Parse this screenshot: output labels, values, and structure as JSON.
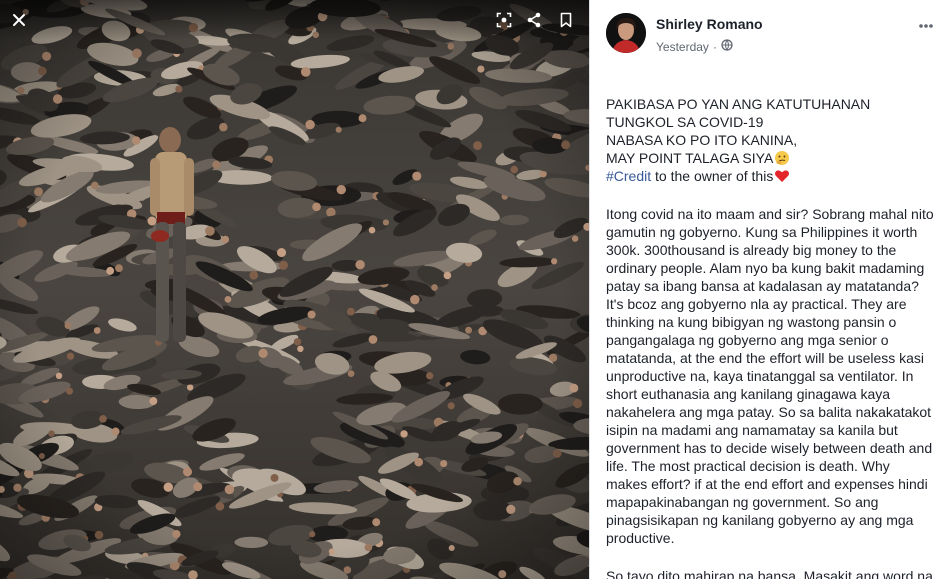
{
  "viewer": {
    "toolbar": {
      "close_icon": "close-icon",
      "fullscreen_icon": "fullscreen-icon",
      "share_icon": "share-icon",
      "bookmark_icon": "bookmark-icon"
    },
    "photo": {
      "alt": "Crowd of people lying on the ground with a man standing among them"
    }
  },
  "post": {
    "author": "Shirley Romano",
    "timestamp": "Yesterday",
    "audience_icon": "globe-icon",
    "more_icon": "more-options-icon",
    "intro": {
      "line1": "PAKIBASA PO YAN ANG KATUTUHANAN",
      "line2": "TUNGKOL SA COVID-19",
      "line3": "NABASA KO PO ITO KANINA,",
      "line4": "MAY POINT TALAGA SIYA",
      "hashtag": "#Credit",
      "credit_rest": " to the owner of this"
    },
    "body_lines": [
      "Itong covid na ito maam and sir? Sobrang mahal nito",
      "gamutin ng gobyerno. Kung sa Philippines it worth",
      "300k. 300thousand is already big money to the",
      "ordinary people. Alam nyo ba kung bakit madaming",
      "patay sa ibang bansa at kadalasan ay matatanda?",
      "It's bcoz ang gobyerno nla ay practical. They are",
      "thinking na kung bibigyan ng wastong pansin o",
      "pangangalaga ng gobyerno ang mga senior o",
      "matatanda, at the end the effort will be useless kasi",
      "unproductive na, kaya tinatanggal sa ventilator. In",
      "short euthanasia ang kanilang ginagawa kaya",
      "nakahelera ang mga patay. So sa balita nakakatakot",
      "isipin na madami ang namamatay sa kanila but",
      "government has to decide wisely between death and",
      "life. The most practical decision is death. Why",
      "makes effort? if at the end effort and expenses hindi",
      "mapapakinabangan ng government. So ang",
      "pinagsisikapan ng kanilang gobyerno ay ang mga",
      "productive."
    ],
    "last_line": "So tayo dito mahirap na bansa. Masakit ang word na",
    "colors": {
      "link": "#385898",
      "text": "#1d2129",
      "meta": "#616770"
    }
  }
}
